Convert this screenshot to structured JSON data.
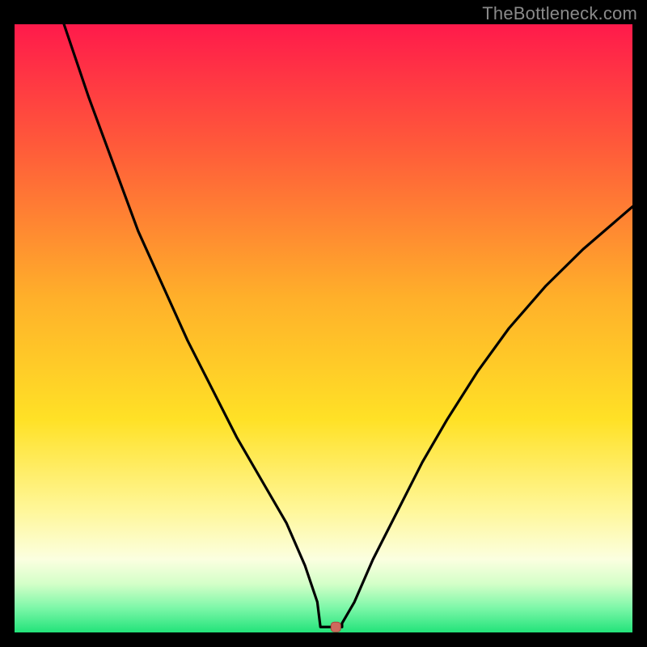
{
  "watermark": "TheBottleneck.com",
  "colors": {
    "frame": "#000000",
    "curve_stroke": "#000000",
    "marker_fill": "#cf6a5d",
    "marker_stroke": "#a8493e",
    "gradient_stops": [
      {
        "offset": 0.0,
        "color": "#ff1a4b"
      },
      {
        "offset": 0.2,
        "color": "#ff5a3a"
      },
      {
        "offset": 0.45,
        "color": "#ffb02a"
      },
      {
        "offset": 0.65,
        "color": "#ffe126"
      },
      {
        "offset": 0.8,
        "color": "#fff79a"
      },
      {
        "offset": 0.88,
        "color": "#fbffe0"
      },
      {
        "offset": 0.92,
        "color": "#d4ffc8"
      },
      {
        "offset": 0.96,
        "color": "#7cf7a8"
      },
      {
        "offset": 1.0,
        "color": "#22e37a"
      }
    ]
  },
  "chart_data": {
    "type": "line",
    "title": "",
    "xlabel": "",
    "ylabel": "",
    "xlim": [
      0,
      100
    ],
    "ylim": [
      0,
      100
    ],
    "grid": false,
    "legend": false,
    "series": [
      {
        "name": "bottleneck-curve",
        "x": [
          8,
          12,
          16,
          20,
          24,
          28,
          32,
          36,
          40,
          44,
          47,
          49,
          50,
          51,
          52,
          53,
          55,
          58,
          62,
          66,
          70,
          75,
          80,
          86,
          92,
          100
        ],
        "values": [
          100,
          88,
          77,
          66,
          57,
          48,
          40,
          32,
          25,
          18,
          11,
          5,
          1.5,
          0.9,
          0.9,
          1.5,
          5,
          12,
          20,
          28,
          35,
          43,
          50,
          57,
          63,
          70
        ]
      }
    ],
    "marker": {
      "x": 52,
      "y": 0.9
    },
    "flat_bottom": {
      "x_start": 49.5,
      "x_end": 53,
      "y": 0.9
    }
  }
}
